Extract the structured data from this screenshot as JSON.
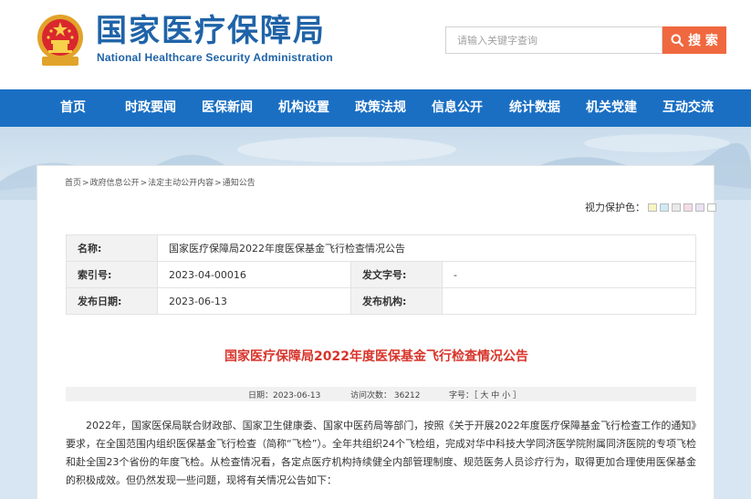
{
  "site": {
    "title_cn": "国家医疗保障局",
    "title_en": "National Healthcare Security Administration",
    "search_placeholder": "请输入关键字查询",
    "search_button": "搜 索"
  },
  "nav": [
    "首页",
    "时政要闻",
    "医保新闻",
    "机构设置",
    "政策法规",
    "信息公开",
    "统计数据",
    "机关党建",
    "互动交流"
  ],
  "breadcrumb": [
    "首页",
    "政府信息公开",
    "法定主动公开内容",
    "通知公告"
  ],
  "breadcrumb_sep": ">",
  "vision_label": "视力保护色：",
  "vision_colors": [
    "#f8f3c4",
    "#cfeaf5",
    "#e9e9e9",
    "#f6dbe6",
    "#e9e2f3",
    "#ffffff"
  ],
  "meta": {
    "name_label": "名称:",
    "name_value": "国家医疗保障局2022年度医保基金飞行检查情况公告",
    "index_label": "索引号:",
    "index_value": "2023-04-00016",
    "doc_label": "发文字号:",
    "doc_value": "-",
    "date_label": "发布日期:",
    "date_value": "2023-06-13",
    "org_label": "发布机构:",
    "org_value": ""
  },
  "article": {
    "title": "国家医疗保障局2022年度医保基金飞行检查情况公告",
    "date_text": "日期：2023-06-13",
    "views_text": "访问次数：  36212",
    "font_text": "字号：［ 大 中 小 ］",
    "paragraph": "2022年，国家医保局联合财政部、国家卫生健康委、国家中医药局等部门，按照《关于开展2022年度医疗保障基金飞行检查工作的通知》要求，在全国范围内组织医保基金飞行检查（简称“飞检”）。全年共组织24个飞检组，完成对华中科技大学同济医学院附属同济医院的专项飞检和赴全国23个省份的年度飞检。从检查情况看，各定点医疗机构持续健全内部管理制度、规范医务人员诊疗行为，取得更加合理使用医保基金的积极成效。但仍然发现一些问题，现将有关情况公告如下："
  },
  "colors": {
    "brand_blue": "#1f63a8",
    "nav_blue": "#1a6fc3",
    "search_orange": "#f0683f",
    "title_red": "#d8342a"
  }
}
